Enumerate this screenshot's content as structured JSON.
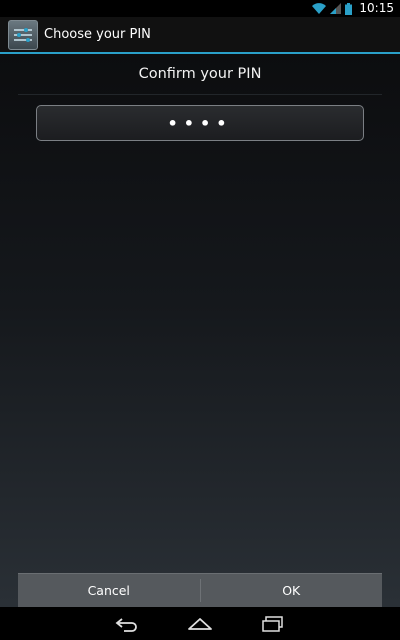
{
  "status_bar": {
    "time": "10:15",
    "icons": [
      "wifi-icon",
      "signal-icon",
      "battery-icon"
    ]
  },
  "action_bar": {
    "title": "Choose your PIN",
    "icon": "settings-sliders-icon"
  },
  "main": {
    "heading": "Confirm your PIN",
    "pin_value": "••••"
  },
  "buttons": {
    "cancel_label": "Cancel",
    "ok_label": "OK"
  },
  "nav_bar": {
    "icons": [
      "back-icon",
      "home-icon",
      "recent-apps-icon"
    ]
  },
  "colors": {
    "accent": "#2aa0c8",
    "button_bar": "#55595d"
  }
}
